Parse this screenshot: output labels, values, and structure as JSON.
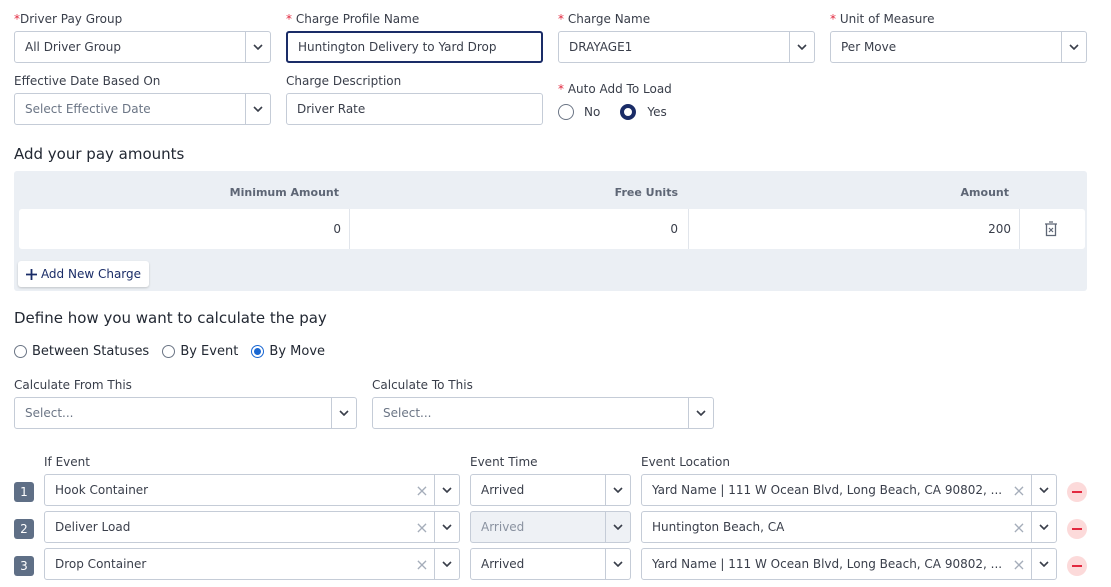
{
  "form": {
    "driver_pay_group": {
      "label": "Driver Pay Group",
      "value": "All Driver Group"
    },
    "charge_profile_name": {
      "label": "Charge Profile Name",
      "value": "Huntington Delivery to Yard Drop"
    },
    "charge_name": {
      "label": "Charge Name",
      "value": "DRAYAGE1"
    },
    "unit_of_measure": {
      "label": "Unit of Measure",
      "value": "Per Move"
    },
    "effective_date": {
      "label": "Effective Date Based On",
      "placeholder": "Select Effective Date"
    },
    "charge_description": {
      "label": "Charge Description",
      "value": "Driver Rate"
    },
    "auto_add": {
      "label": "Auto Add To Load",
      "options": [
        "No",
        "Yes"
      ],
      "selected": "Yes"
    },
    "required_mark": "*"
  },
  "pay_amounts": {
    "title": "Add your pay amounts",
    "columns": [
      "Minimum Amount",
      "Free Units",
      "Amount"
    ],
    "rows": [
      {
        "minimum_amount": "0",
        "free_units": "0",
        "amount": "200"
      }
    ],
    "add_button": "Add New Charge"
  },
  "calculation": {
    "title": "Define how you want to calculate the pay",
    "modes": [
      "Between Statuses",
      "By Event",
      "By Move"
    ],
    "selected_mode": "By Move",
    "calc_from": {
      "label": "Calculate From This",
      "placeholder": "Select..."
    },
    "calc_to": {
      "label": "Calculate To This",
      "placeholder": "Select..."
    }
  },
  "events": {
    "headers": {
      "event": "If Event",
      "time": "Event Time",
      "location": "Event Location"
    },
    "rows": [
      {
        "num": "1",
        "event": "Hook Container",
        "time": "Arrived",
        "location": "Yard Name | 111 W Ocean Blvd, Long Beach, CA 90802, ...",
        "time_disabled": false
      },
      {
        "num": "2",
        "event": "Deliver Load",
        "time": "Arrived",
        "location": "Huntington Beach, CA",
        "time_disabled": true
      },
      {
        "num": "3",
        "event": "Drop Container",
        "time": "Arrived",
        "location": "Yard Name | 111 W Ocean Blvd, Long Beach, CA 90802, ...",
        "time_disabled": false
      }
    ]
  },
  "icons": {
    "dropdown": "chevron-down-icon",
    "clear": "clear-x-icon",
    "delete": "trash-icon",
    "add": "plus-icon",
    "remove": "minus-circle-icon"
  },
  "colors": {
    "accent": "#1a2c67",
    "required": "#e2293f",
    "panel": "#ebeff4",
    "radio_blue": "#1967d2"
  }
}
